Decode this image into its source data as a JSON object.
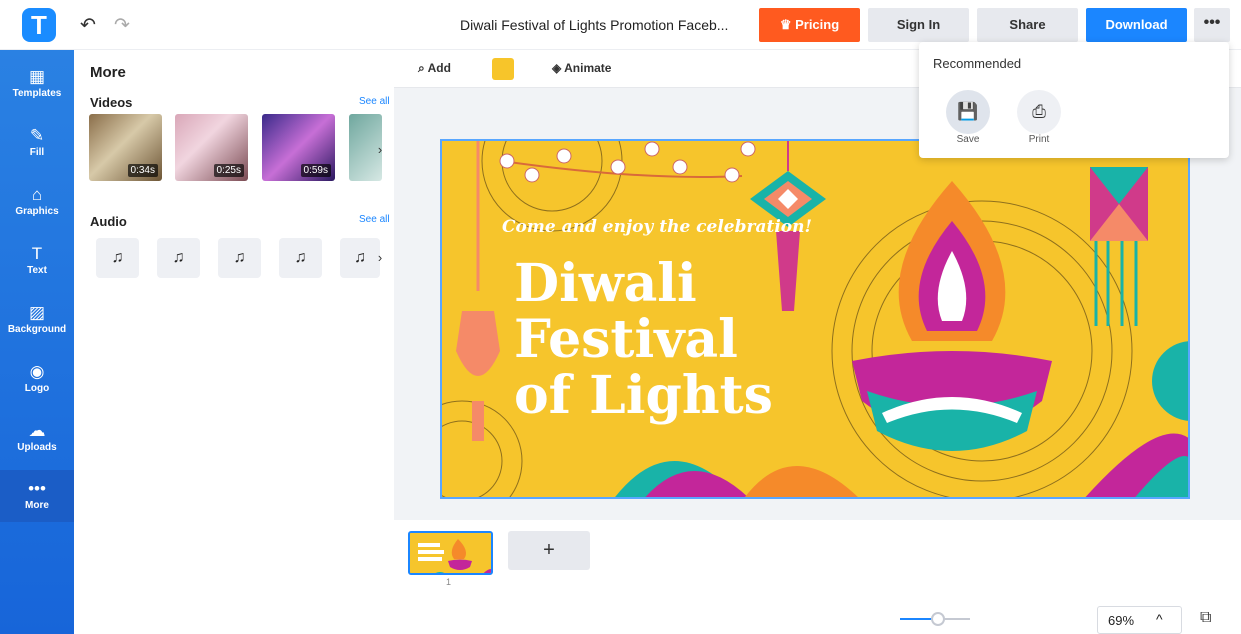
{
  "header": {
    "logo_letter": "T",
    "undo_icon": "↶",
    "redo_icon": "↷",
    "doc_title": "Diwali Festival of Lights Promotion Faceb...",
    "pricing_label": "Pricing",
    "signin_label": "Sign In",
    "share_label": "Share",
    "download_label": "Download",
    "more_label": "•••"
  },
  "sidebar": {
    "items": [
      {
        "label": "Templates",
        "icon": "▦"
      },
      {
        "label": "Fill",
        "icon": "✎"
      },
      {
        "label": "Graphics",
        "icon": "⌂"
      },
      {
        "label": "Text",
        "icon": "T"
      },
      {
        "label": "Background",
        "icon": "▨"
      },
      {
        "label": "Logo",
        "icon": "◉"
      },
      {
        "label": "Uploads",
        "icon": "☁"
      },
      {
        "label": "More",
        "icon": "•••"
      }
    ]
  },
  "panel": {
    "title": "More",
    "videos_label": "Videos",
    "audio_label": "Audio",
    "see_all": "See all",
    "videos": [
      {
        "duration": "0:34s"
      },
      {
        "duration": "0:25s"
      },
      {
        "duration": "0:59s"
      }
    ],
    "audio_icon": "♫",
    "chevron": "›",
    "collapse": "‹"
  },
  "toolbar": {
    "add_label": "Add",
    "animate_label": "Animate",
    "fill_color": "#f7c52a"
  },
  "canvas": {
    "subtitle": "Come and enjoy the celebration!",
    "line1": "Diwali",
    "line2": "Festival",
    "line3": "of Lights"
  },
  "pages": {
    "page_number": "1",
    "add_page": "+"
  },
  "zoom": {
    "value": "69%",
    "slider_fraction": 0.55,
    "chevron": "^"
  },
  "popup": {
    "title": "Recommended",
    "save_label": "Save",
    "print_label": "Print"
  },
  "colors": {
    "brand": "#1b86ff",
    "pricing": "#ff5a1f",
    "canvas_bg": "#f6c52c"
  }
}
